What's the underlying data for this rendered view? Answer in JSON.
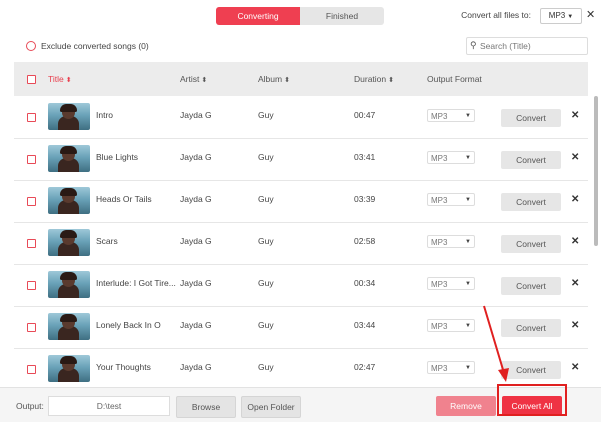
{
  "tabs": {
    "converting": "Converting",
    "finished": "Finished"
  },
  "header": {
    "convert_all_label": "Convert all files to:",
    "format": "MP3"
  },
  "filter": {
    "exclude_label": "Exclude converted songs (0)",
    "search_placeholder": "Search (Title)"
  },
  "columns": {
    "title": "Title",
    "artist": "Artist",
    "album": "Album",
    "duration": "Duration",
    "output_format": "Output Format"
  },
  "rows": [
    {
      "title": "Intro",
      "artist": "Jayda G",
      "album": "Guy",
      "duration": "00:47",
      "format": "MP3",
      "action": "Convert"
    },
    {
      "title": "Blue Lights",
      "artist": "Jayda G",
      "album": "Guy",
      "duration": "03:41",
      "format": "MP3",
      "action": "Convert"
    },
    {
      "title": "Heads Or Tails",
      "artist": "Jayda G",
      "album": "Guy",
      "duration": "03:39",
      "format": "MP3",
      "action": "Convert"
    },
    {
      "title": "Scars",
      "artist": "Jayda G",
      "album": "Guy",
      "duration": "02:58",
      "format": "MP3",
      "action": "Convert"
    },
    {
      "title": "Interlude: I Got Tire...",
      "artist": "Jayda G",
      "album": "Guy",
      "duration": "00:34",
      "format": "MP3",
      "action": "Convert"
    },
    {
      "title": "Lonely Back In O",
      "artist": "Jayda G",
      "album": "Guy",
      "duration": "03:44",
      "format": "MP3",
      "action": "Convert"
    },
    {
      "title": "Your Thoughts",
      "artist": "Jayda G",
      "album": "Guy",
      "duration": "02:47",
      "format": "MP3",
      "action": "Convert"
    }
  ],
  "footer": {
    "output_label": "Output:",
    "output_path": "D:\\test",
    "browse": "Browse",
    "open_folder": "Open Folder",
    "remove": "Remove",
    "convert_all": "Convert All"
  },
  "colors": {
    "accent": "#ef3f51",
    "annotation": "#e02020"
  },
  "icons": {
    "search": "search-icon",
    "close": "close-icon",
    "sort": "sort-icon",
    "caret": "caret-down-icon",
    "delete": "delete-icon"
  }
}
